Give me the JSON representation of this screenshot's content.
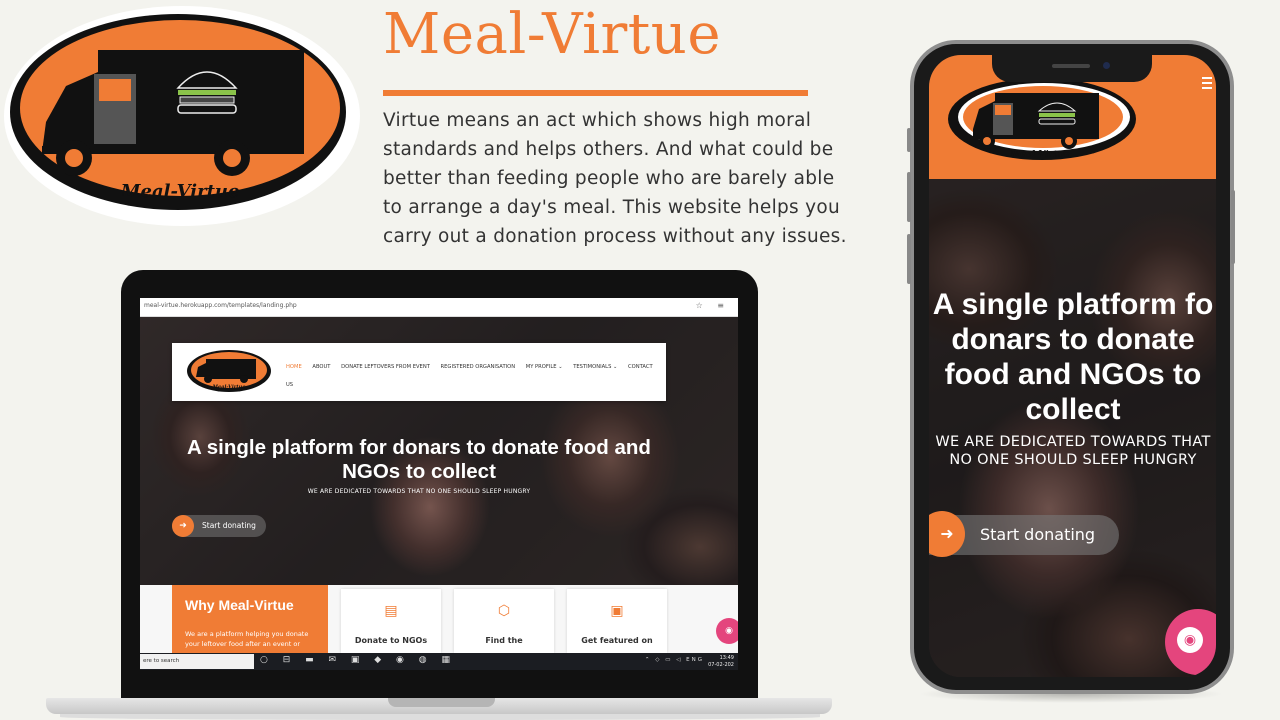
{
  "brand": {
    "title": "Meal-Virtue",
    "logo_text": "Meal-Virtue",
    "description": "Virtue means an act which shows high moral standards and helps others. And what could be better than feeding people who are barely able to arrange a day's meal.  This website helps you carry out a donation process without any issues."
  },
  "colors": {
    "accent": "#f07c35",
    "float_button": "#e4457d"
  },
  "laptop": {
    "url": "meal-virtue.herokuapp.com/templates/landing.php",
    "nav": {
      "home": "HOME",
      "about": "ABOUT",
      "donate": "DONATE LEFTOVERS FROM EVENT",
      "registered": "REGISTERED ORGANISATION",
      "profile": "MY PROFILE ⌄",
      "testimonials": "TESTIMONIALS ⌄",
      "contact": "CONTACT US"
    },
    "hero": {
      "title": "A single platform for donars to donate food and NGOs to collect",
      "subtitle": "WE ARE DEDICATED TOWARDS THAT NO ONE SHOULD SLEEP HUNGRY",
      "button": "Start donating"
    },
    "why": {
      "title": "Why Meal-Virtue",
      "text": "We are a platform helping you donate your leftover food after an event or"
    },
    "cards": [
      "Donate to NGOs",
      "Find the",
      "Get featured on"
    ],
    "taskbar": {
      "search": "ere to search",
      "tray_lang": "ENG",
      "time": "13:49",
      "date": "07-02-202"
    }
  },
  "phone": {
    "title": "A single platform fo donars to donate food and NGOs to collect",
    "subtitle": "WE ARE DEDICATED TOWARDS THAT NO ONE SHOULD SLEEP HUNGRY",
    "button": "Start donating"
  }
}
